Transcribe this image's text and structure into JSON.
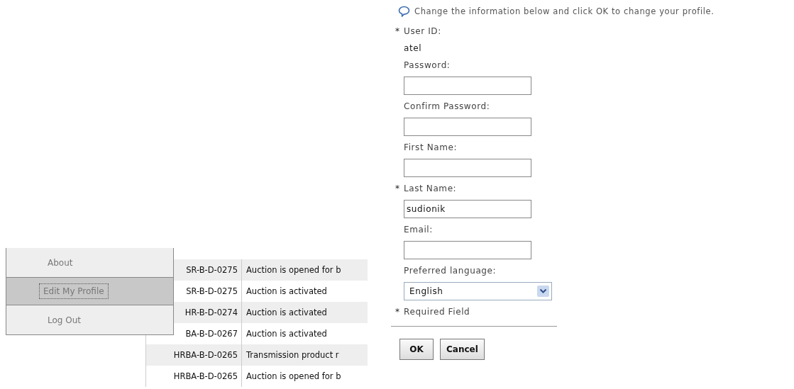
{
  "menu": {
    "items": [
      {
        "label": "About",
        "selected": false
      },
      {
        "label": "Edit My Profile",
        "selected": true
      },
      {
        "label": "Log Out",
        "selected": false
      }
    ]
  },
  "table": {
    "rows": [
      {
        "column_1": "SR-B-D-0275",
        "column_2": "Auction is opened for b"
      },
      {
        "column_1": "SR-B-D-0275",
        "column_2": "Auction is activated"
      },
      {
        "column_1": "HR-B-D-0274",
        "column_2": "Auction is activated"
      },
      {
        "column_1": "BA-B-D-0267",
        "column_2": "Auction is activated"
      },
      {
        "column_1": "HRBA-B-D-0265",
        "column_2": "Transmission product r"
      },
      {
        "column_1": "HRBA-B-D-0265",
        "column_2": "Auction is opened for b"
      }
    ]
  },
  "form": {
    "intro": "Change the information below and click OK to change your profile.",
    "required_mark": "*",
    "fields": [
      {
        "kind": "static",
        "label": "User ID:",
        "required": true,
        "value": "atel"
      },
      {
        "kind": "text",
        "label": "Password:",
        "required": false
      },
      {
        "kind": "text",
        "label": "Confirm Password:",
        "required": false
      },
      {
        "kind": "text",
        "label": "First Name:",
        "required": false
      },
      {
        "kind": "text",
        "label": "Last Name:",
        "required": true,
        "value": "sudionik"
      },
      {
        "kind": "text",
        "label": "Email:",
        "required": false
      },
      {
        "kind": "select",
        "label": "Preferred language:",
        "required": false,
        "value": "English"
      }
    ],
    "required_note": "Required Field",
    "buttons": [
      "OK",
      "Cancel"
    ]
  }
}
